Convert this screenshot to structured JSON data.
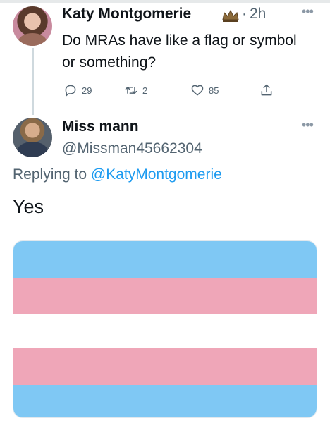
{
  "parent_tweet": {
    "name": "Katy Montgomerie",
    "time_separator": "·",
    "time": "2h",
    "text": "Do MRAs have like a flag or symbol or something?",
    "actions": {
      "reply_count": "29",
      "retweet_count": "2",
      "like_count": "85"
    },
    "more_icon": "ellipsis-icon"
  },
  "reply_tweet": {
    "name": "Miss mann",
    "handle": "@Missman45662304",
    "replying_prefix": "Replying to",
    "replying_to": "@KatyMontgomerie",
    "text": "Yes",
    "image": {
      "description_colors": [
        "#7fc8f4",
        "#efa6b8",
        "#ffffff",
        "#efa6b8",
        "#7fc8f4"
      ]
    }
  },
  "colors": {
    "link": "#1d9bf0",
    "secondary_text": "#536471",
    "primary_text": "#0f1419"
  }
}
